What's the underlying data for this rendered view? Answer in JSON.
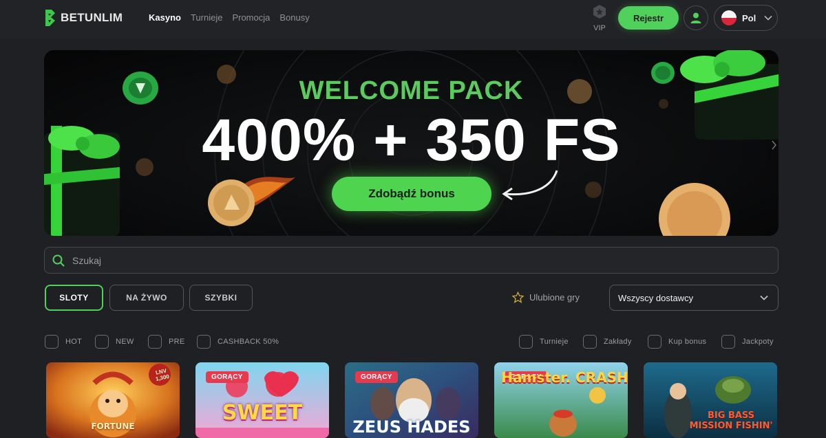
{
  "brand": {
    "name": "BETUNLIM",
    "accent": "#4fd15c"
  },
  "nav": [
    {
      "label": "Kasyno",
      "active": true
    },
    {
      "label": "Turnieje",
      "active": false
    },
    {
      "label": "Promocja",
      "active": false
    },
    {
      "label": "Bonusy",
      "active": false
    }
  ],
  "header": {
    "vip_label": "VIP",
    "vip_icon": "vip-badge-icon",
    "register_label": "Rejestr",
    "user_icon": "user-icon",
    "language": {
      "label": "Pol",
      "flag": "poland-flag-icon"
    }
  },
  "banner": {
    "kicker": "WELCOME PACK",
    "headline": "400% + 350 FS",
    "cta_label": "Zdobądź bonus",
    "kicker_color": "#5ccb5f"
  },
  "search": {
    "placeholder": "Szukaj",
    "value": ""
  },
  "categories": [
    {
      "label": "SLOTY",
      "active": true
    },
    {
      "label": "NA ŻYWO",
      "active": false
    },
    {
      "label": "SZYBKI",
      "active": false
    }
  ],
  "favorites_label": "Ulubione gry",
  "provider_select": {
    "selected": "Wszyscy dostawcy"
  },
  "filters_left": [
    {
      "label": "HOT",
      "checked": false
    },
    {
      "label": "NEW",
      "checked": false
    },
    {
      "label": "PRE",
      "checked": false
    },
    {
      "label": "CASHBACK 50%",
      "checked": false
    }
  ],
  "filters_right": [
    {
      "label": "Turnieje",
      "checked": false
    },
    {
      "label": "Zakłady",
      "checked": false
    },
    {
      "label": "Kup bonus",
      "checked": false
    },
    {
      "label": "Jackpoty",
      "checked": false
    }
  ],
  "games": [
    {
      "title": "FORTUNE",
      "badge": "",
      "corner_tag": "LNV 1,300"
    },
    {
      "title": "SWEET",
      "badge": "GORĄCY",
      "corner_tag": ""
    },
    {
      "title": "ZEUS HADES",
      "badge": "GORĄCY",
      "corner_tag": ""
    },
    {
      "title": "Hamster. CRASH!",
      "badge": "GORĄCY",
      "corner_tag": ""
    },
    {
      "title": "BIG BASS MISSION FISHIN'",
      "badge": "",
      "corner_tag": ""
    }
  ]
}
